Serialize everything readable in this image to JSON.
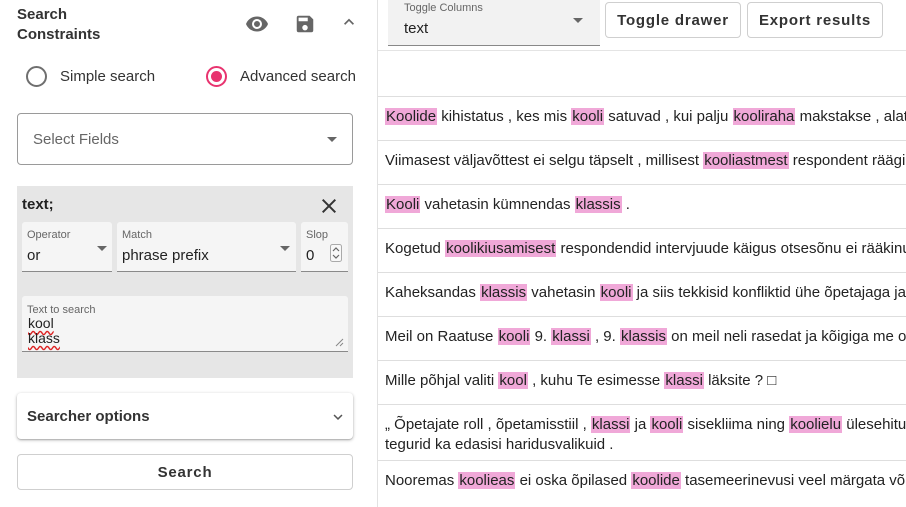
{
  "constraints_panel": {
    "title_line1": "Search",
    "title_line2": "Constraints",
    "icons": [
      "eye-icon",
      "save-icon",
      "chevron-up-icon"
    ],
    "modes": [
      {
        "label": "Simple search",
        "selected": false
      },
      {
        "label": "Advanced search",
        "selected": true
      }
    ],
    "select_fields_placeholder": "Select Fields",
    "constraint": {
      "title": "text;",
      "operator_label": "Operator",
      "operator_value": "or",
      "match_label": "Match",
      "match_value": "phrase prefix",
      "slop_label": "Slop",
      "slop_value": "0",
      "text_label": "Text to search",
      "text_lines": [
        "kool",
        "klass"
      ]
    },
    "searcher_options_label": "Searcher options",
    "search_button": "Search",
    "accent_color": "#e8336f"
  },
  "toolbar": {
    "toggle_columns_label": "Toggle Columns",
    "toggle_columns_value": "text",
    "toggle_drawer": "Toggle drawer",
    "export_results": "Export results"
  },
  "results": {
    "highlight_color": "#f0a8d8",
    "rows": [
      [
        {
          "t": "Koolide",
          "h": true
        },
        {
          "t": " kihistatus , kes mis ",
          "h": false
        },
        {
          "t": "kooli",
          "h": true
        },
        {
          "t": " satuvad , kui palju ",
          "h": false
        },
        {
          "t": "kooliraha",
          "h": true
        },
        {
          "t": " makstakse , alates c",
          "h": false
        }
      ],
      [
        {
          "t": "Viimasest väljavõttest ei selgu täpselt , millisest ",
          "h": false
        },
        {
          "t": "kooliastmest",
          "h": true
        },
        {
          "t": " respondent räägib",
          "h": false
        }
      ],
      [
        {
          "t": "Kooli",
          "h": true
        },
        {
          "t": " vahetasin kümnendas ",
          "h": false
        },
        {
          "t": "klassis",
          "h": true
        },
        {
          "t": " .",
          "h": false
        }
      ],
      [
        {
          "t": "Kogetud ",
          "h": false
        },
        {
          "t": "koolikiusamisest",
          "h": true
        },
        {
          "t": " respondendid intervjuude käigus otsesõnu ei rääkinud",
          "h": false
        }
      ],
      [
        {
          "t": "Kaheksandas ",
          "h": false
        },
        {
          "t": "klassis",
          "h": true
        },
        {
          "t": " vahetasin ",
          "h": false
        },
        {
          "t": "kooli",
          "h": true
        },
        {
          "t": " ja siis tekkisid konfliktid ühe õpetajaga ja põ",
          "h": false
        }
      ],
      [
        {
          "t": "Meil on Raatuse ",
          "h": false
        },
        {
          "t": "kooli",
          "h": true
        },
        {
          "t": " 9. ",
          "h": false
        },
        {
          "t": "klassi",
          "h": true
        },
        {
          "t": " , 9. ",
          "h": false
        },
        {
          "t": "klassis",
          "h": true
        },
        {
          "t": " on meil neli rasedat ja kõigiga me omav",
          "h": false
        }
      ],
      [
        {
          "t": "Mille põhjal valiti ",
          "h": false
        },
        {
          "t": "kool",
          "h": true
        },
        {
          "t": " , kuhu Te esimesse ",
          "h": false
        },
        {
          "t": "klassi",
          "h": true
        },
        {
          "t": " läksite ? ",
          "h": false
        },
        {
          "t": "□",
          "h": false
        }
      ],
      [
        {
          "t": "„ Õpetajate roll , õpetamisstiil , ",
          "h": false
        },
        {
          "t": "klassi",
          "h": true
        },
        {
          "t": " ja ",
          "h": false
        },
        {
          "t": "kooli",
          "h": true
        },
        {
          "t": " sisekliima ning ",
          "h": false
        },
        {
          "t": "koolielu",
          "h": true
        },
        {
          "t": " ülesehitus m",
          "h": false
        }
      ],
      [
        {
          "t": "Nooremas ",
          "h": false
        },
        {
          "t": "koolieas",
          "h": true
        },
        {
          "t": " ei oska õpilased ",
          "h": false
        },
        {
          "t": "koolide",
          "h": true
        },
        {
          "t": " tasemeerinevusi veel märgata või vä",
          "h": false
        }
      ]
    ],
    "row8_line2": "tegurid ka edasisi haridusvalikuid ."
  }
}
